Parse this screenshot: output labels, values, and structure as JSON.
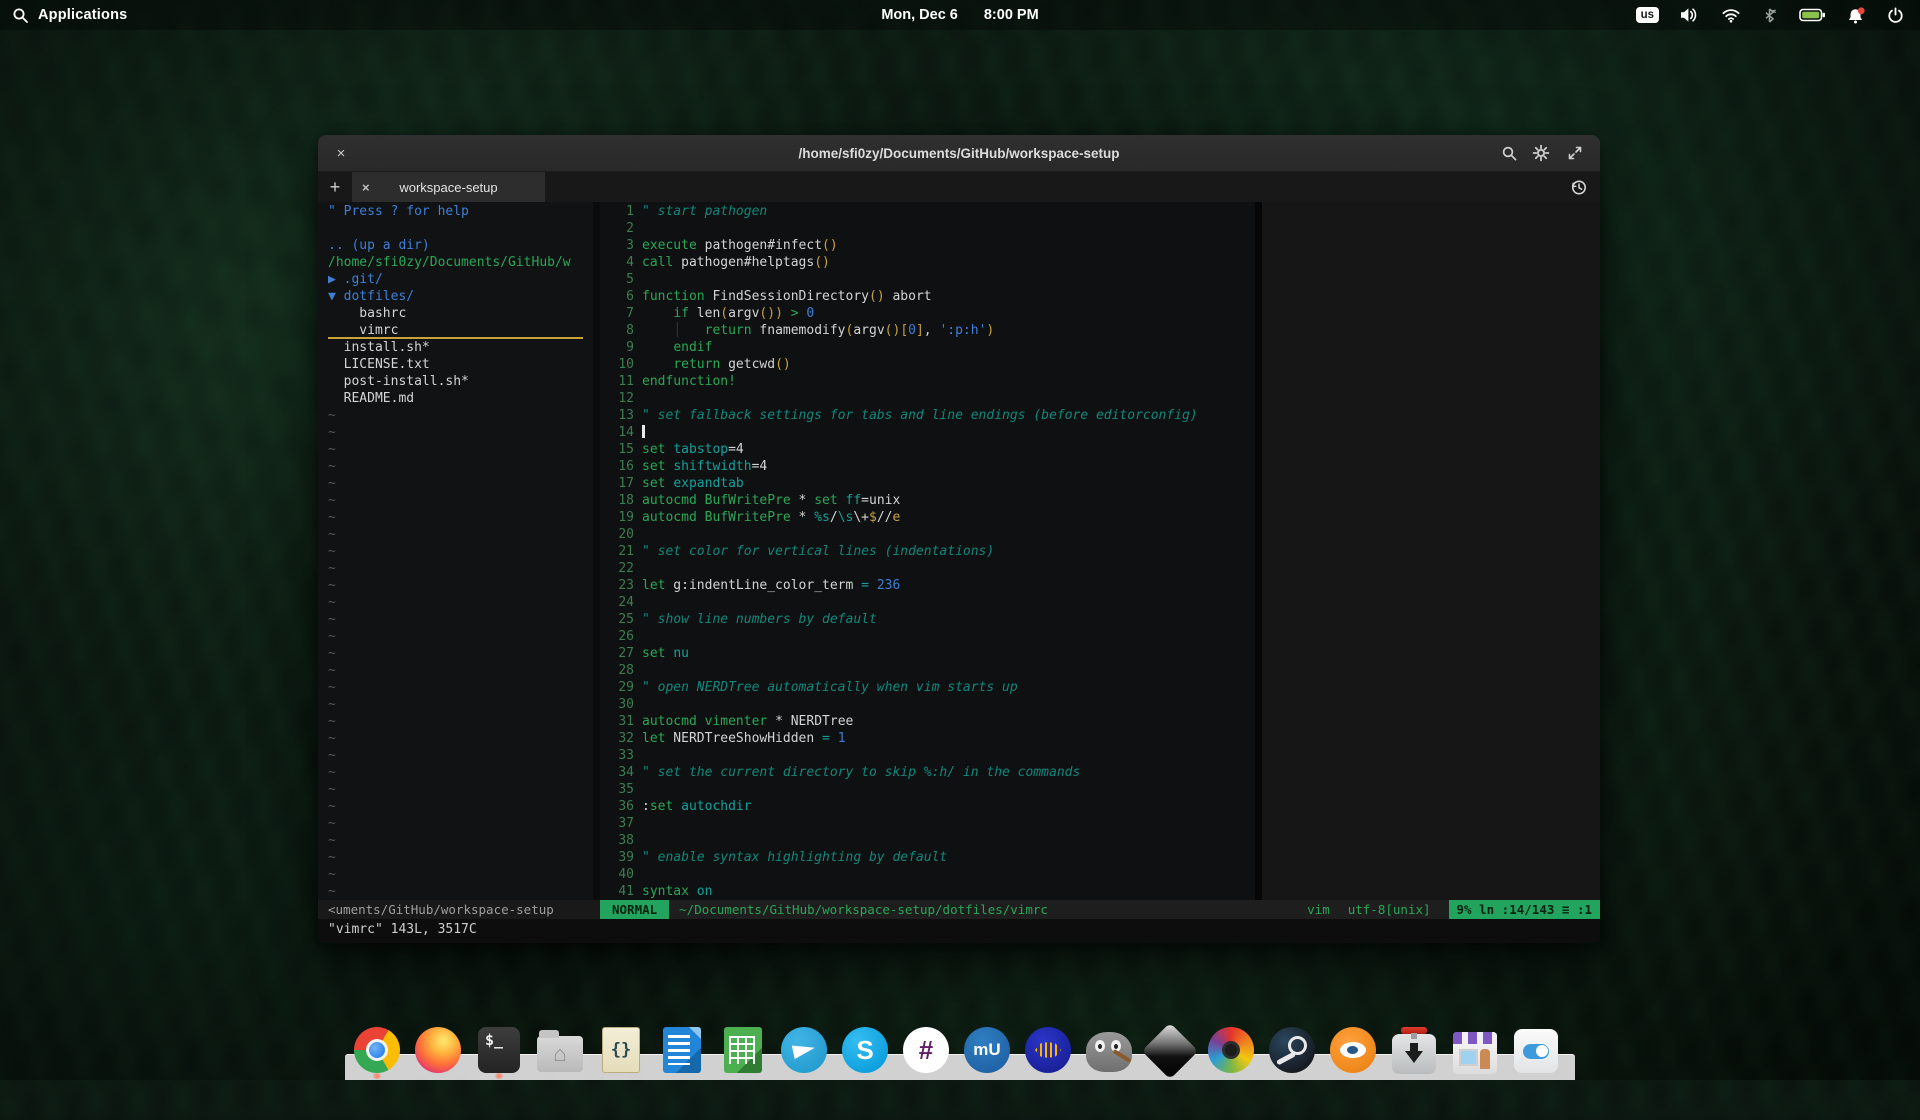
{
  "panel": {
    "app_menu": "Applications",
    "date": "Mon, Dec 6",
    "time": "8:00 PM",
    "keyboard_layout": "us"
  },
  "window": {
    "title": "/home/sfi0zy/Documents/GitHub/workspace-setup",
    "tab_label": "workspace-setup",
    "close_glyph": "×",
    "tab_close_glyph": "×",
    "new_tab_glyph": "+"
  },
  "nerdtree": {
    "total_rows": 41,
    "rows": [
      {
        "c": "blue",
        "t": "\" Press ? for help"
      },
      {
        "c": "plain",
        "t": ""
      },
      {
        "c": "blue",
        "t": ".. (up a dir)"
      },
      {
        "c": "green",
        "t": "/home/sfi0zy/Documents/GitHub/w"
      },
      {
        "c": "blue",
        "t": "▶ .git/"
      },
      {
        "c": "blue",
        "t": "▼ dotfiles/"
      },
      {
        "c": "plain",
        "t": "    bashrc"
      },
      {
        "c": "plain",
        "t": "    vimrc",
        "selected": true
      },
      {
        "c": "plain",
        "t": "  install.sh*"
      },
      {
        "c": "plain",
        "t": "  LICENSE.txt"
      },
      {
        "c": "plain",
        "t": "  post-install.sh*"
      },
      {
        "c": "plain",
        "t": "  README.md"
      }
    ]
  },
  "editor": {
    "lines": [
      {
        "n": "1",
        "t": [
          [
            "cm",
            "\" start pathogen"
          ]
        ]
      },
      {
        "n": "2",
        "t": []
      },
      {
        "n": "3",
        "t": [
          [
            "kw",
            "execute"
          ],
          [
            "pl",
            " pathogen#infect"
          ],
          [
            "par",
            "()"
          ]
        ]
      },
      {
        "n": "4",
        "t": [
          [
            "kw",
            "call"
          ],
          [
            "pl",
            " pathogen#helptags"
          ],
          [
            "par",
            "()"
          ]
        ]
      },
      {
        "n": "5",
        "t": []
      },
      {
        "n": "6",
        "t": [
          [
            "kw",
            "function"
          ],
          [
            "pl",
            " FindSessionDirectory"
          ],
          [
            "par",
            "()"
          ],
          [
            "pl",
            " abort"
          ]
        ]
      },
      {
        "n": "7",
        "t": [
          [
            "pl",
            "    "
          ],
          [
            "kw",
            "if"
          ],
          [
            "pl",
            " len"
          ],
          [
            "par",
            "("
          ],
          [
            "pl",
            "argv"
          ],
          [
            "par",
            "()"
          ],
          [
            "par",
            ")"
          ],
          [
            "kw",
            " > "
          ],
          [
            "num",
            "0"
          ]
        ]
      },
      {
        "n": "8",
        "t": [
          [
            "pl",
            "    "
          ],
          [
            "gd",
            "│"
          ],
          [
            "pl",
            "   "
          ],
          [
            "kw",
            "return"
          ],
          [
            "pl",
            " fnamemodify"
          ],
          [
            "par",
            "("
          ],
          [
            "pl",
            "argv"
          ],
          [
            "par",
            "()"
          ],
          [
            "par",
            "["
          ],
          [
            "num",
            "0"
          ],
          [
            "par",
            "]"
          ],
          [
            "pl",
            ", "
          ],
          [
            "str",
            "':p:h'"
          ],
          [
            "par",
            ")"
          ]
        ]
      },
      {
        "n": "9",
        "t": [
          [
            "pl",
            "    "
          ],
          [
            "kw",
            "endif"
          ]
        ]
      },
      {
        "n": "10",
        "t": [
          [
            "pl",
            "    "
          ],
          [
            "kw",
            "return"
          ],
          [
            "pl",
            " getcwd"
          ],
          [
            "par",
            "()"
          ]
        ]
      },
      {
        "n": "11",
        "t": [
          [
            "kw",
            "endfunction!"
          ]
        ]
      },
      {
        "n": "12",
        "t": []
      },
      {
        "n": "13",
        "t": [
          [
            "cm",
            "\" set fallback settings for tabs and line endings (before editorconfig)"
          ]
        ]
      },
      {
        "n": "14",
        "t": [
          [
            "cur",
            " "
          ]
        ]
      },
      {
        "n": "15",
        "t": [
          [
            "kw",
            "set"
          ],
          [
            "pl",
            " "
          ],
          [
            "id",
            "tabstop"
          ],
          [
            "pl",
            "=4"
          ]
        ]
      },
      {
        "n": "16",
        "t": [
          [
            "kw",
            "set"
          ],
          [
            "pl",
            " "
          ],
          [
            "id",
            "shiftwidth"
          ],
          [
            "pl",
            "=4"
          ]
        ]
      },
      {
        "n": "17",
        "t": [
          [
            "kw",
            "set"
          ],
          [
            "pl",
            " "
          ],
          [
            "id",
            "expandtab"
          ]
        ]
      },
      {
        "n": "18",
        "t": [
          [
            "kw",
            "autocmd"
          ],
          [
            "pl",
            " "
          ],
          [
            "kw",
            "BufWritePre"
          ],
          [
            "pl",
            " * "
          ],
          [
            "kw",
            "set"
          ],
          [
            "pl",
            " "
          ],
          [
            "id",
            "ff"
          ],
          [
            "pl",
            "=unix"
          ]
        ]
      },
      {
        "n": "19",
        "t": [
          [
            "kw",
            "autocmd"
          ],
          [
            "pl",
            " "
          ],
          [
            "kw",
            "BufWritePre"
          ],
          [
            "pl",
            " * "
          ],
          [
            "id",
            "%s"
          ],
          [
            "pl",
            "/"
          ],
          [
            "id",
            "\\s"
          ],
          [
            "pl",
            "\\+"
          ],
          [
            "par",
            "$"
          ],
          [
            "pl",
            "//"
          ],
          [
            "par",
            "e"
          ]
        ]
      },
      {
        "n": "20",
        "t": []
      },
      {
        "n": "21",
        "t": [
          [
            "cm",
            "\" set color for vertical lines (indentations)"
          ]
        ]
      },
      {
        "n": "22",
        "t": []
      },
      {
        "n": "23",
        "t": [
          [
            "kw",
            "let"
          ],
          [
            "pl",
            " g:indentLine_color_term "
          ],
          [
            "id",
            "="
          ],
          [
            "pl",
            " "
          ],
          [
            "num",
            "236"
          ]
        ]
      },
      {
        "n": "24",
        "t": []
      },
      {
        "n": "25",
        "t": [
          [
            "cm",
            "\" show line numbers by default"
          ]
        ]
      },
      {
        "n": "26",
        "t": []
      },
      {
        "n": "27",
        "t": [
          [
            "kw",
            "set"
          ],
          [
            "pl",
            " "
          ],
          [
            "id",
            "nu"
          ]
        ]
      },
      {
        "n": "28",
        "t": []
      },
      {
        "n": "29",
        "t": [
          [
            "cm",
            "\" open NERDTree automatically when vim starts up"
          ]
        ]
      },
      {
        "n": "30",
        "t": []
      },
      {
        "n": "31",
        "t": [
          [
            "kw",
            "autocmd"
          ],
          [
            "pl",
            " "
          ],
          [
            "kw",
            "vimenter"
          ],
          [
            "pl",
            " * NERDTree"
          ]
        ]
      },
      {
        "n": "32",
        "t": [
          [
            "kw",
            "let"
          ],
          [
            "pl",
            " NERDTreeShowHidden "
          ],
          [
            "id",
            "="
          ],
          [
            "pl",
            " "
          ],
          [
            "num",
            "1"
          ]
        ]
      },
      {
        "n": "33",
        "t": []
      },
      {
        "n": "34",
        "t": [
          [
            "cm",
            "\" set the current directory to skip %:h/ in the commands"
          ]
        ]
      },
      {
        "n": "35",
        "t": []
      },
      {
        "n": "36",
        "t": [
          [
            "pl",
            ":"
          ],
          [
            "kw",
            "set"
          ],
          [
            "pl",
            " "
          ],
          [
            "id",
            "autochdir"
          ]
        ]
      },
      {
        "n": "37",
        "t": []
      },
      {
        "n": "38",
        "t": []
      },
      {
        "n": "39",
        "t": [
          [
            "cm",
            "\" enable syntax highlighting by default"
          ]
        ]
      },
      {
        "n": "40",
        "t": []
      },
      {
        "n": "41",
        "t": [
          [
            "kw",
            "syntax"
          ],
          [
            "pl",
            " "
          ],
          [
            "id",
            "on"
          ]
        ]
      }
    ]
  },
  "statusbar": {
    "nerdtree_status": "<uments/GitHub/workspace-setup",
    "mode": "NORMAL",
    "file_path": "~/Documents/GitHub/workspace-setup/dotfiles/vimrc",
    "filetype": "vim",
    "encoding": "utf-8[unix]",
    "position": "9% ln :14/143 ≡ :1"
  },
  "cmdline": "\"vimrc\" 143L, 3517C",
  "dock": {
    "items": [
      {
        "id": "chrome",
        "running": true
      },
      {
        "id": "firefox",
        "running": false
      },
      {
        "id": "terminal",
        "running": true,
        "glyph": "$_"
      },
      {
        "id": "files",
        "glyph": "⌂"
      },
      {
        "id": "code-editor",
        "glyph": "{}"
      },
      {
        "id": "libreoffice-writer"
      },
      {
        "id": "libreoffice-calc"
      },
      {
        "id": "telegram"
      },
      {
        "id": "skype",
        "glyph": "S"
      },
      {
        "id": "slack",
        "glyph": "#"
      },
      {
        "id": "musescore",
        "glyph": "mU"
      },
      {
        "id": "audacity"
      },
      {
        "id": "gimp"
      },
      {
        "id": "inkscape"
      },
      {
        "id": "photos"
      },
      {
        "id": "steam"
      },
      {
        "id": "blender"
      },
      {
        "id": "package-installer"
      },
      {
        "id": "app-store"
      },
      {
        "id": "system-settings"
      }
    ]
  },
  "colors": {
    "accent_green": "#23a45e",
    "keyword_green": "#2aa757",
    "comment_teal": "#11877b",
    "identifier_teal": "#14a09a",
    "number_blue": "#3f7fd6",
    "paren_yellow": "#c9a23a",
    "selection_underline": "#c9a23a",
    "text": "#d4d4d4",
    "line_number_green": "#3c7d52"
  }
}
